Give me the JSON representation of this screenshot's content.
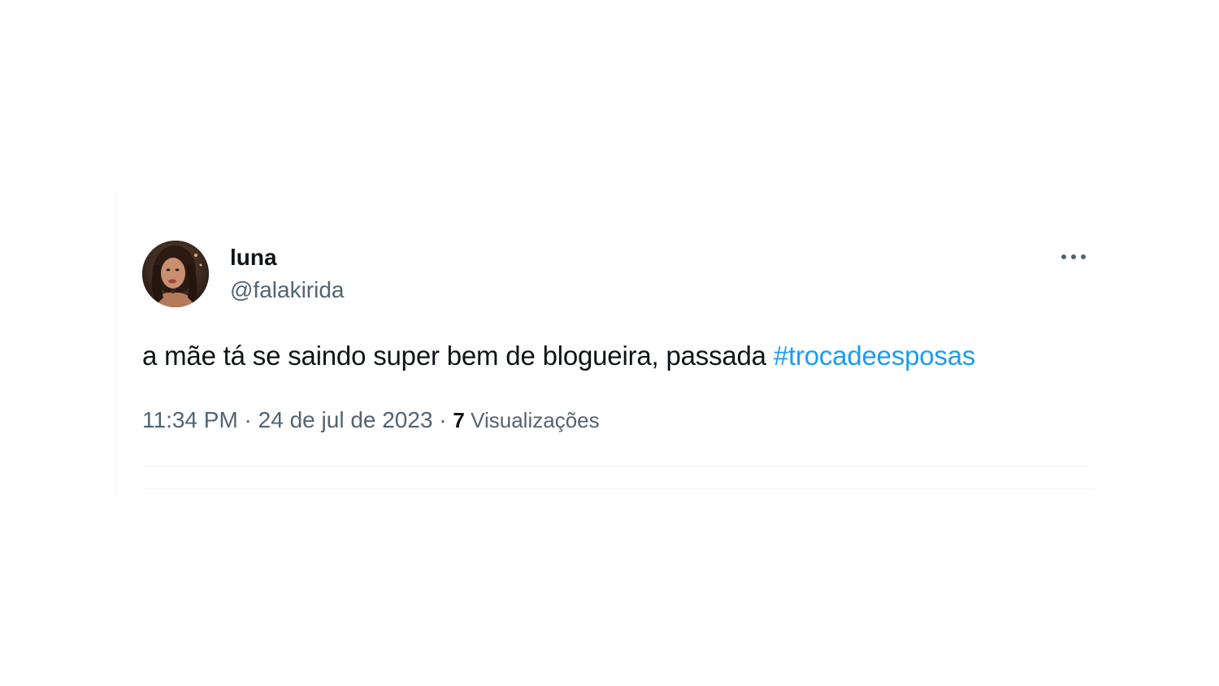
{
  "tweet": {
    "display_name": "luna",
    "handle": "@falakirida",
    "text": "a mãe tá se saindo super bem de blogueira, passada ",
    "hashtag": "#trocadeesposas",
    "time": "11:34 PM",
    "separator": " · ",
    "date": "24 de jul de 2023",
    "views_count": "7",
    "views_label": " Visualizações"
  },
  "icons": {
    "avatar": "profile-photo",
    "more": "more-horizontal-icon"
  },
  "colors": {
    "text_primary": "#0f1419",
    "text_secondary": "#536471",
    "link": "#1d9bf0",
    "divider": "#eff3f4"
  }
}
